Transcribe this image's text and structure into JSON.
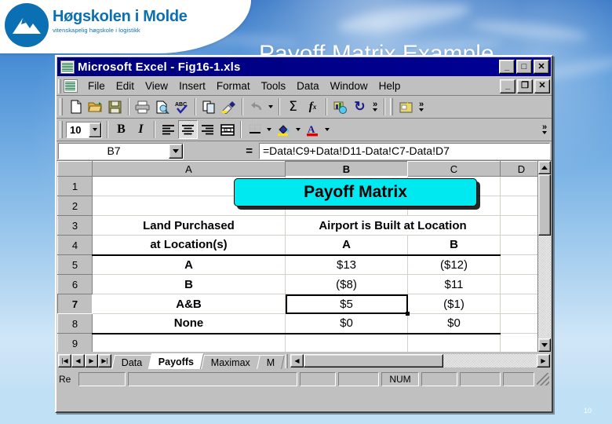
{
  "slide": {
    "logo": {
      "title": "Høgskolen i Molde",
      "subtitle": "vitenskapelig høgskole i logistikk",
      "mark_icon": "mountain-logo-icon",
      "brand_color": "#0b6fb4"
    },
    "title": "Payoff Matrix Example",
    "page_number": "10"
  },
  "window": {
    "title": "Microsoft Excel - Fig16-1.xls",
    "app_icon": "excel-icon",
    "buttons": {
      "minimize": "_",
      "maximize": "□",
      "close": "✕"
    }
  },
  "menu": {
    "doc_icon": "excel-document-icon",
    "items": [
      {
        "label": "File",
        "accel": "F"
      },
      {
        "label": "Edit",
        "accel": "E"
      },
      {
        "label": "View",
        "accel": "V"
      },
      {
        "label": "Insert",
        "accel": "I"
      },
      {
        "label": "Format",
        "accel": "o"
      },
      {
        "label": "Tools",
        "accel": "T"
      },
      {
        "label": "Data",
        "accel": "D"
      },
      {
        "label": "Window",
        "accel": "W"
      },
      {
        "label": "Help",
        "accel": "H"
      }
    ],
    "doc_buttons": {
      "minimize": "_",
      "restore": "❐",
      "close": "✕"
    }
  },
  "standard_toolbar": {
    "buttons": [
      {
        "name": "new-icon",
        "glyph": "📄"
      },
      {
        "name": "open-icon",
        "glyph": "📂"
      },
      {
        "name": "save-icon",
        "glyph": "💾"
      },
      {
        "name": "print-icon",
        "glyph": "🖨"
      },
      {
        "name": "print-preview-icon",
        "glyph": "🔍"
      },
      {
        "name": "spelling-icon",
        "glyph": "ABC"
      },
      {
        "name": "copy-icon",
        "glyph": "⧉"
      },
      {
        "name": "format-painter-icon",
        "glyph": "🖌"
      },
      {
        "name": "undo-icon",
        "glyph": "↩"
      },
      {
        "name": "autosum-icon",
        "glyph": "Σ"
      },
      {
        "name": "paste-function-icon",
        "glyph": "fx"
      },
      {
        "name": "chart-wizard-icon",
        "glyph": "📊"
      },
      {
        "name": "refresh-icon",
        "glyph": "↻"
      }
    ],
    "more_label": "»"
  },
  "formatting_toolbar": {
    "font_size": "10",
    "bold_label": "B",
    "italic_label": "I",
    "align_left": "align-left-icon",
    "align_center": "align-center-icon",
    "align_right": "align-right-icon",
    "merge_center": "merge-and-center-icon",
    "borders": "borders-icon",
    "fill_color": "fill-color-icon",
    "font_color": "font-color-icon",
    "fill_swatch": "#ffe400",
    "font_swatch": "#e00000",
    "more_label": "»"
  },
  "formula_bar": {
    "name_box": "B7",
    "equals_label": "=",
    "formula": "=Data!C9+Data!D11-Data!C7-Data!D7"
  },
  "sheet": {
    "column_headers": [
      "A",
      "B",
      "C",
      "D"
    ],
    "active_column": "B",
    "active_row": "7",
    "row_numbers": [
      "1",
      "2",
      "3",
      "4",
      "5",
      "6",
      "7",
      "8",
      "9"
    ],
    "banner_text": "Payoff Matrix",
    "banner_color": "#00e8f0",
    "rows": [
      {
        "num": "1",
        "a": "",
        "b": "",
        "c": "",
        "d": ""
      },
      {
        "num": "2",
        "a": "",
        "b": "",
        "c": "",
        "d": ""
      },
      {
        "num": "3",
        "a": "Land Purchased",
        "b": "Airport is Built at Location",
        "c": "",
        "d": ""
      },
      {
        "num": "4",
        "a": "at Location(s)",
        "b": "A",
        "c": "B",
        "d": ""
      },
      {
        "num": "5",
        "a": "A",
        "b": "$13",
        "c": "($12)",
        "d": ""
      },
      {
        "num": "6",
        "a": "B",
        "b": "($8)",
        "c": "$11",
        "d": ""
      },
      {
        "num": "7",
        "a": "A&B",
        "b": "$5",
        "c": "($1)",
        "d": ""
      },
      {
        "num": "8",
        "a": "None",
        "b": "$0",
        "c": "$0",
        "d": ""
      },
      {
        "num": "9",
        "a": "",
        "b": "",
        "c": "",
        "d": ""
      }
    ],
    "selected_cell": "B7"
  },
  "tab_bar": {
    "nav_first": "|◀",
    "nav_prev": "◀",
    "nav_next": "▶",
    "nav_last": "▶|",
    "tabs": [
      {
        "label": "Data",
        "active": false
      },
      {
        "label": "Payoffs",
        "active": true
      },
      {
        "label": "Maximax",
        "active": false
      },
      {
        "label": "M",
        "active": false
      }
    ],
    "hscroll_left": "◀",
    "hscroll_right": "▶"
  },
  "status_bar": {
    "mode": "Re",
    "num_lock": "NUM"
  },
  "chart_data": {
    "type": "table",
    "title": "Payoff Matrix",
    "row_header": "Land Purchased at Location(s)",
    "column_header": "Airport is Built at Location",
    "categories": [
      "A",
      "B"
    ],
    "rows": [
      {
        "name": "A",
        "values": [
          13,
          -12
        ]
      },
      {
        "name": "B",
        "values": [
          -8,
          11
        ]
      },
      {
        "name": "A&B",
        "values": [
          5,
          -1
        ]
      },
      {
        "name": "None",
        "values": [
          0,
          0
        ]
      }
    ],
    "display_values": [
      [
        "$13",
        "($12)"
      ],
      [
        "($8)",
        "$11"
      ],
      [
        "$5",
        "($1)"
      ],
      [
        "$0",
        "$0"
      ]
    ],
    "xlabel": "Airport is Built at Location",
    "ylabel": "Land Purchased at Location(s)"
  }
}
